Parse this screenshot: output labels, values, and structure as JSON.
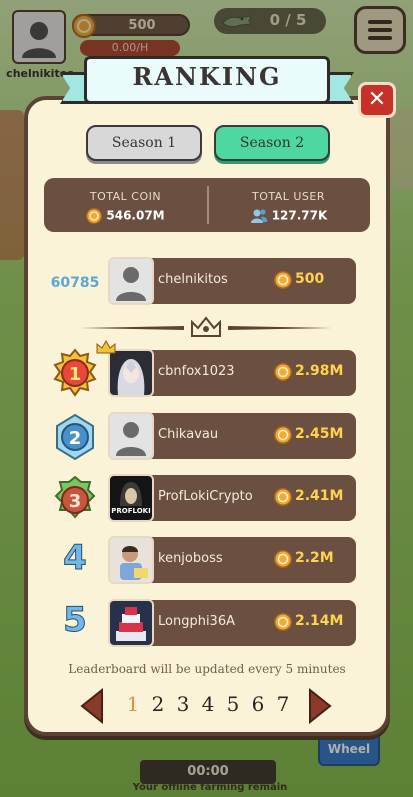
{
  "hud": {
    "username": "chelnikitos",
    "coins": "500",
    "sub_counter": "0.00/H",
    "croc_counter": "0 / 5"
  },
  "ranking": {
    "title": "RANKING",
    "close_symbol": "✕",
    "seasons": [
      {
        "label": "Season 1",
        "active": false
      },
      {
        "label": "Season 2",
        "active": true
      }
    ],
    "stats": {
      "total_coin_label": "TOTAL COIN",
      "total_coin_value": "546.07M",
      "total_user_label": "TOTAL USER",
      "total_user_value": "127.77K"
    },
    "me": {
      "rank": "60785",
      "name": "chelnikitos",
      "score": "500"
    },
    "top": [
      {
        "rank": "1",
        "name": "cbnfox1023",
        "score": "2.98M",
        "avatar": "anime-avatar"
      },
      {
        "rank": "2",
        "name": "Chikavau",
        "score": "2.45M",
        "avatar": "default-avatar"
      },
      {
        "rank": "3",
        "name": "ProfLokiCrypto",
        "score": "2.41M",
        "avatar": "profloki-avatar",
        "avatar_text": "PROFLOKI"
      },
      {
        "rank": "4",
        "name": "kenjoboss",
        "score": "2.2M",
        "avatar": "child-photo-avatar"
      },
      {
        "rank": "5",
        "name": "Longphi36A",
        "score": "2.14M",
        "avatar": "cake-avatar"
      }
    ],
    "note": "Leaderboard will be updated every 5 minutes",
    "pages": [
      "1",
      "2",
      "3",
      "4",
      "5",
      "6",
      "7"
    ],
    "current_page": "1"
  },
  "background": {
    "timer": "00:00",
    "caption": "Your offline farming remain",
    "wheel_label": "Wheel"
  },
  "colors": {
    "panel_bg": "#fbf3d8",
    "row_bg": "#6b4f40",
    "season_active": "#4fd7a1",
    "season_inactive": "#d8d8d8",
    "score_gold": "#ffd34d",
    "close_red": "#c8312a",
    "page_active": "#f08a3c"
  }
}
